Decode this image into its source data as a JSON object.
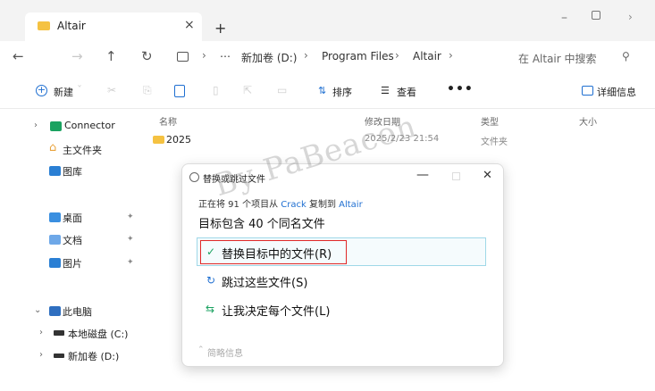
{
  "tab": {
    "title": "Altair",
    "close": "×",
    "add": "+"
  },
  "window": {
    "minimize": "–",
    "more": "›"
  },
  "nav": {
    "back": "←",
    "forward": "→",
    "up": "↑",
    "refresh": "↻",
    "breadcrumb": [
      "⋯",
      "新加卷 (D:)",
      "Program Files",
      "Altair"
    ],
    "sep": "›",
    "search_placeholder": "在 Altair 中搜索",
    "search_icon": "⚲"
  },
  "cmd": {
    "new_label": "新建",
    "new_chev": "ˇ",
    "sort_label": "排序",
    "view_label": "查看",
    "more": "•••",
    "details_label": "详细信息",
    "sort_icon": "⇅",
    "view_icon": "☰"
  },
  "sidebar": {
    "items": [
      {
        "label": "Connector"
      },
      {
        "label": "主文件夹"
      },
      {
        "label": "图库"
      },
      {
        "label": "桌面"
      },
      {
        "label": "文档"
      },
      {
        "label": "图片"
      },
      {
        "label": "此电脑"
      },
      {
        "label": "本地磁盘 (C:)"
      },
      {
        "label": "新加卷 (D:)"
      }
    ],
    "pin": "📌"
  },
  "file_list": {
    "columns": {
      "name": "名称",
      "date": "修改日期",
      "type": "类型",
      "size": "大小"
    },
    "rows": [
      {
        "name": "2025",
        "date": "2025/2/23 21:54",
        "type": "文件夹"
      }
    ]
  },
  "watermark": "By PaBeacon",
  "dialog": {
    "title": "替换或跳过文件",
    "minimize": "—",
    "close": "✕",
    "progress_prefix": "正在将 91 个项目从 ",
    "progress_src": "Crack",
    "progress_mid": " 复制到 ",
    "progress_dst": "Altair",
    "heading": "目标包含 40 个同名文件",
    "options": [
      {
        "icon": "✓",
        "label": "替换目标中的文件(R)"
      },
      {
        "icon": "↻",
        "label": "跳过这些文件(S)"
      },
      {
        "icon": "⇆",
        "label": "让我决定每个文件(L)"
      }
    ],
    "info_label": "简略信息",
    "info_chev": "⌃"
  },
  "colors": {
    "accent": "#1f6fd1",
    "highlight": "#e02828",
    "folder": "#f5c242"
  }
}
